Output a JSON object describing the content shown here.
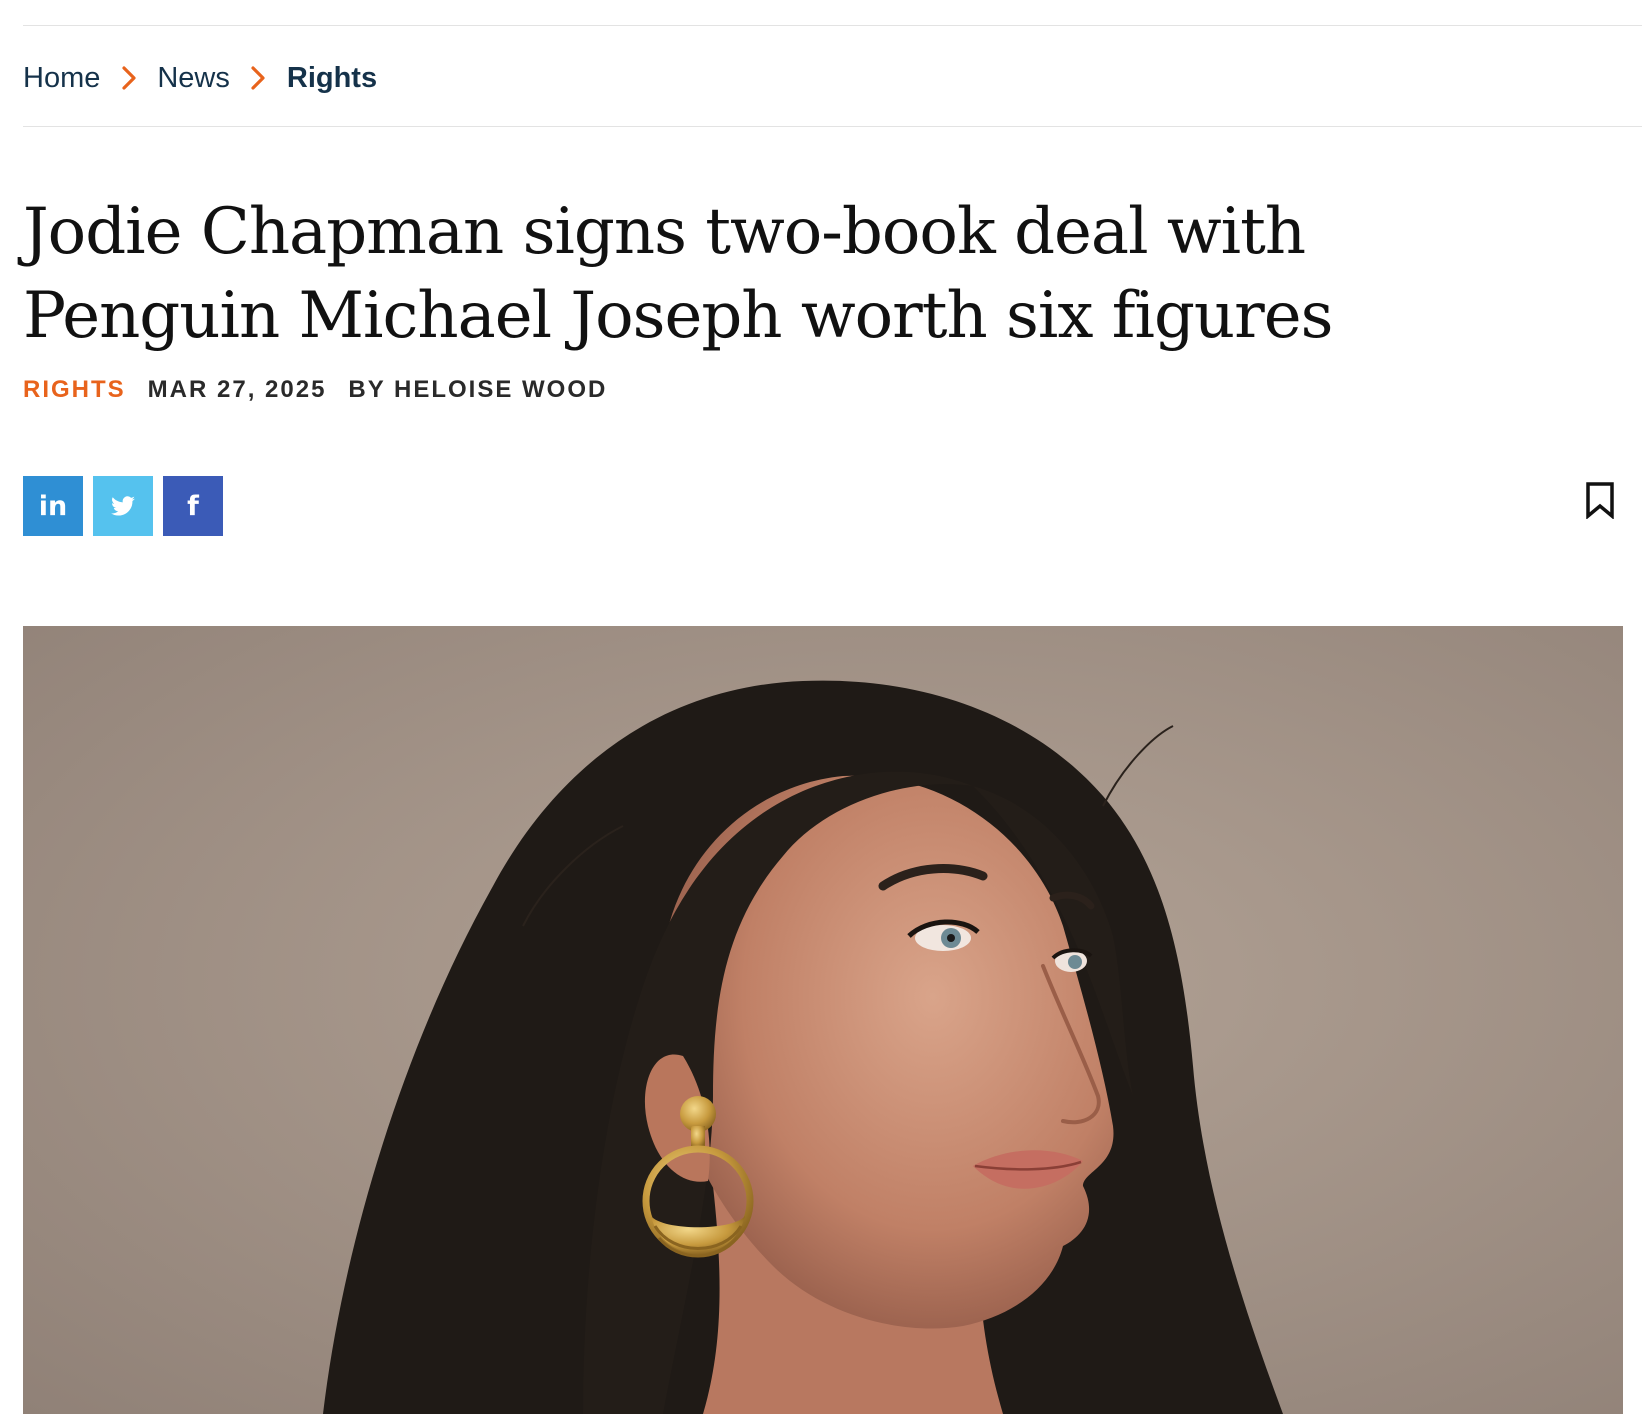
{
  "breadcrumb": {
    "items": [
      {
        "label": "Home"
      },
      {
        "label": "News"
      },
      {
        "label": "Rights"
      }
    ]
  },
  "article": {
    "title": "Jodie Chapman signs two-book deal with Penguin Michael Joseph worth six figures",
    "category": "RIGHTS",
    "date": "MAR 27, 2025",
    "byline": "BY HELOISE WOOD"
  },
  "share": {
    "linkedin_label": "in",
    "facebook_label": "f"
  },
  "icons": {
    "breadcrumb_separator": "chevron-right-icon",
    "linkedin": "linkedin-icon",
    "twitter": "twitter-icon",
    "facebook": "facebook-icon",
    "bookmark": "bookmark-icon"
  },
  "colors": {
    "accent": "#e8631c",
    "breadcrumb_text": "#15324a",
    "linkedin": "#2f8fd4",
    "twitter": "#55c2ee",
    "facebook": "#3b5bb7"
  },
  "hero_image": {
    "subject": "author-portrait"
  }
}
